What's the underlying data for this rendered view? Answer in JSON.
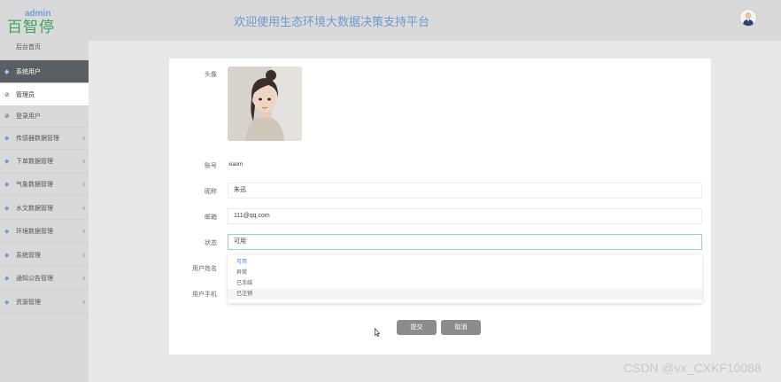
{
  "sidebar": {
    "logo_text": "百智停",
    "admin_label": "admin",
    "items": [
      {
        "label": "后台首页"
      },
      {
        "label": "系统用户"
      },
      {
        "label": "管理员"
      },
      {
        "label": "登录用户"
      },
      {
        "label": "传感器数据管理"
      },
      {
        "label": "下单数据管理"
      },
      {
        "label": "气象数据管理"
      },
      {
        "label": "水文数据管理"
      },
      {
        "label": "环境数据管理"
      },
      {
        "label": "系统管理"
      },
      {
        "label": "通知公告管理"
      },
      {
        "label": "资源管理"
      }
    ]
  },
  "header": {
    "title": "欢迎使用生态环境大数据决策支持平台"
  },
  "form": {
    "avatar_label": "头像",
    "account_label": "账号",
    "account_value": "xiaom",
    "nickname_label": "昵称",
    "nickname_value": "朱迅",
    "email_label": "邮箱",
    "email_value": "111@qq.com",
    "status_label": "状态",
    "status_value": "可用",
    "username_label": "用户姓名",
    "phone_label": "用户手机",
    "status_options": [
      {
        "label": "可用"
      },
      {
        "label": "异常"
      },
      {
        "label": "已冻结"
      },
      {
        "label": "已注销"
      }
    ],
    "submit_label": "提交",
    "cancel_label": "取消"
  },
  "watermark": "CSDN @vx_CXKF10088",
  "colors": {
    "title_blue": "#6c9ad0",
    "active_sidebar": "#5b5f63",
    "button_gray": "#8c8c8c",
    "logo_green": "#3aa35a"
  }
}
